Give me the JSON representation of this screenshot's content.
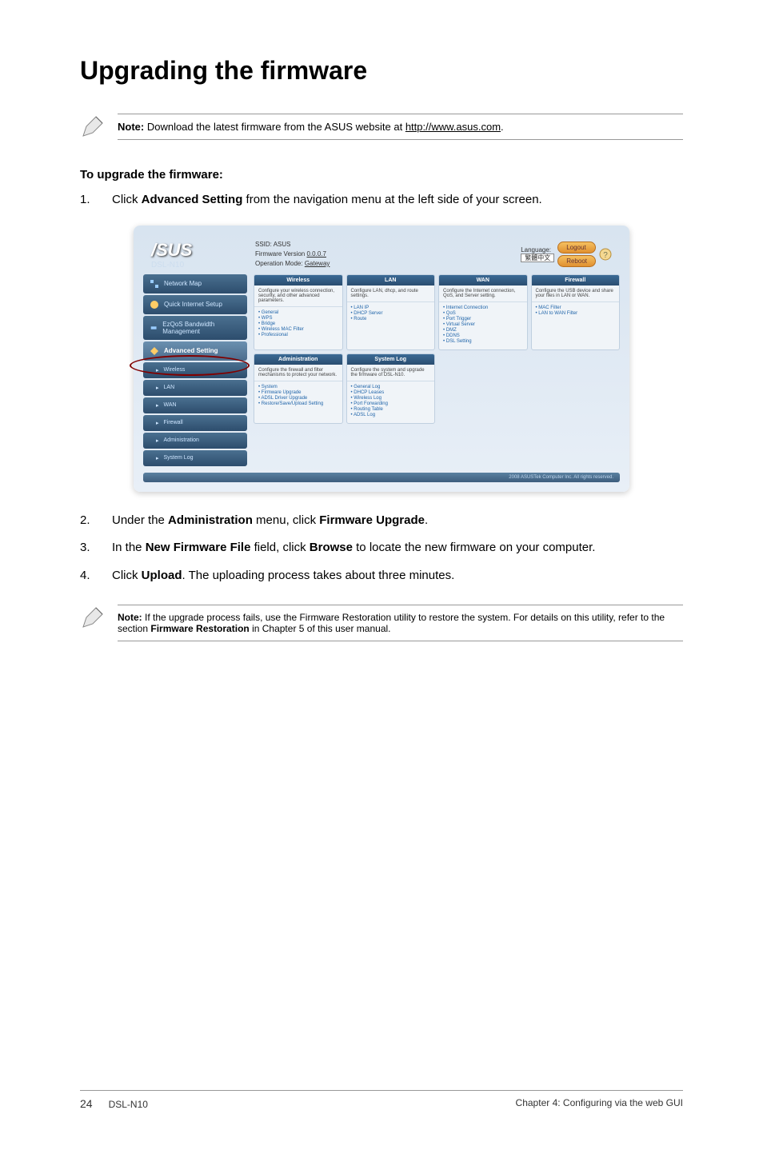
{
  "title": "Upgrading the firmware",
  "note1": {
    "label": "Note:",
    "text": " Download the latest firmware from the ASUS website at ",
    "link": "http://www.asus.com",
    "suffix": "."
  },
  "subheading": "To upgrade the firmware:",
  "steps": {
    "s1": {
      "num": "1.",
      "pre": "Click ",
      "bold": "Advanced Setting",
      "post": " from the navigation menu at the left side of your screen."
    },
    "s2": {
      "num": "2.",
      "pre": "Under the ",
      "bold1": "Administration",
      "mid": " menu, click ",
      "bold2": "Firmware Upgrade",
      "post": "."
    },
    "s3": {
      "num": "3.",
      "pre": "In the ",
      "bold1": "New Firmware File",
      "mid": " field, click ",
      "bold2": "Browse",
      "post": " to locate the new firmware on your computer."
    },
    "s4": {
      "num": "4.",
      "pre": "Click ",
      "bold": "Upload",
      "post": ". The uploading process takes about three minutes."
    }
  },
  "note2": {
    "label": "Note:",
    "text": " If the upgrade process fails, use the Firmware Restoration utility to restore the system. For details on this utility, refer to the section ",
    "bold": "Firmware Restoration",
    "suffix": " in Chapter 5 of this user manual."
  },
  "router": {
    "logo": "/SUS",
    "model": "DSL-N10",
    "ssid_label": "SSID:",
    "ssid_value": "ASUS",
    "fw_label": "Firmware Version",
    "fw_value": "0.0.0.7",
    "mode_label": "Operation Mode:",
    "mode_value": "Gateway",
    "lang_label": "Language:",
    "lang_value": "繁體中文",
    "logout": "Logout",
    "reboot": "Reboot",
    "sidebar": {
      "map": "Network Map",
      "quick": "Quick Internet Setup",
      "ezqos": "EzQoS Bandwidth Management",
      "advanced": "Advanced Setting",
      "wireless": "Wireless",
      "lan": "LAN",
      "wan": "WAN",
      "firewall": "Firewall",
      "admin": "Administration",
      "syslog": "System Log"
    },
    "cards": {
      "wireless": {
        "title": "Wireless",
        "desc": "Configure your wireless connection, security, and other advanced parameters.",
        "items": [
          "General",
          "WPS",
          "Bridge",
          "Wireless MAC Filter",
          "Professional"
        ]
      },
      "lan": {
        "title": "LAN",
        "desc": "Configure LAN, dhcp, and route settings.",
        "items": [
          "LAN IP",
          "DHCP Server",
          "Route"
        ]
      },
      "wan": {
        "title": "WAN",
        "desc": "Configure the Internet connection, QoS, and Server setting.",
        "items": [
          "Internet Connection",
          "QoS",
          "Port Trigger",
          "Virtual Server",
          "DMZ",
          "DDNS",
          "DSL Setting"
        ]
      },
      "firewall": {
        "title": "Firewall",
        "desc": "Configure the USB device and share your files in LAN or WAN.",
        "items": [
          "MAC Filter",
          "LAN to WAN Filter"
        ]
      },
      "admin": {
        "title": "Administration",
        "desc": "Configure the firewall and filter mechanisms to protect your network.",
        "items": [
          "System",
          "Firmware Upgrade",
          "ADSL Driver Upgrade",
          "Restore/Save/Upload Setting"
        ]
      },
      "syslog": {
        "title": "System Log",
        "desc": "Configure the system and upgrade the firmware of DSL-N10.",
        "items": [
          "General Log",
          "DHCP Leases",
          "Wireless Log",
          "Port Forwarding",
          "Routing Table",
          "ADSL Log"
        ]
      }
    },
    "copyright": "2008 ASUSTek Computer Inc. All rights reserved."
  },
  "footer": {
    "page": "24",
    "model": "DSL-N10",
    "chapter": "Chapter 4: Configuring via the web GUI"
  }
}
